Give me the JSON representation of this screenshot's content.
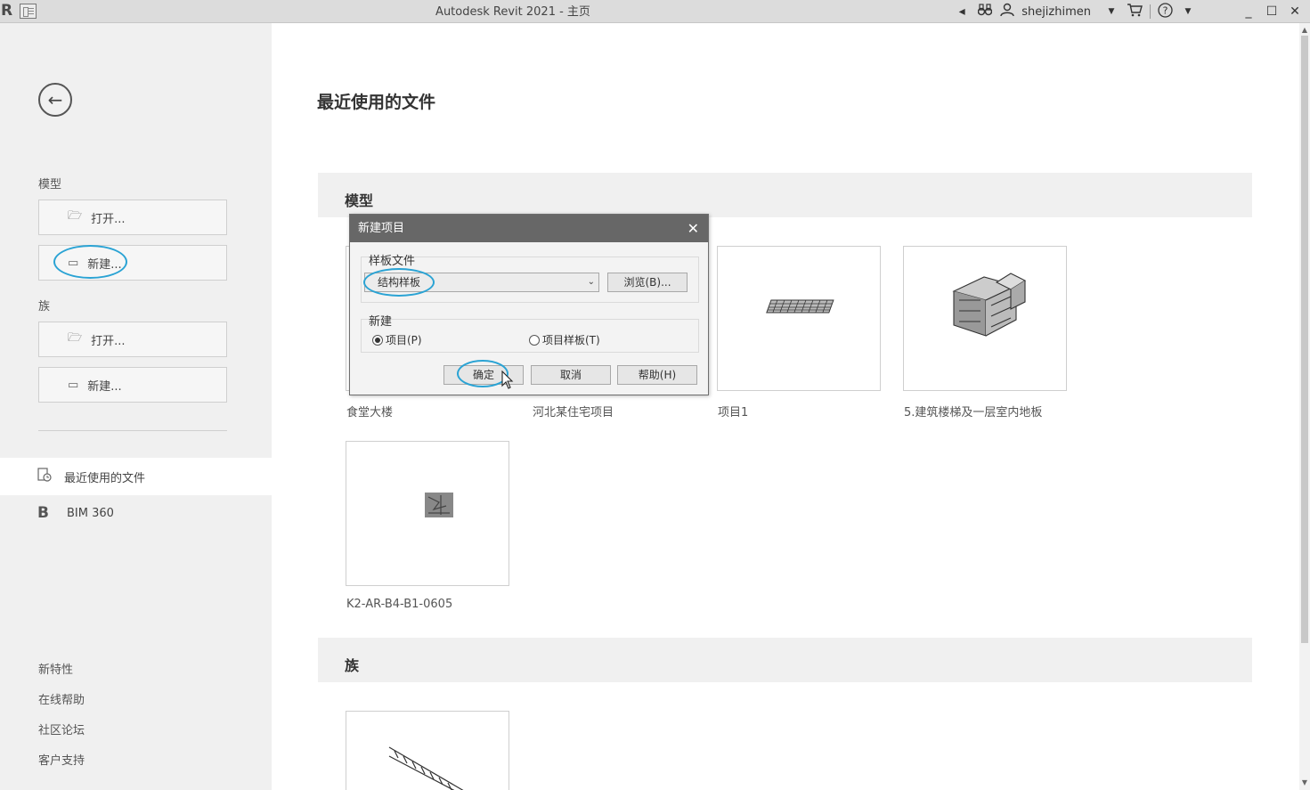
{
  "titlebar": {
    "app_logo": "R",
    "title": "Autodesk Revit 2021 - 主页",
    "username": "shejizhimen",
    "colors": {
      "bar": "#dcdcdc"
    }
  },
  "sidebar": {
    "model_heading": "模型",
    "model_open": "打开...",
    "model_new": "新建...",
    "family_heading": "族",
    "family_open": "打开...",
    "family_new": "新建...",
    "recent_files": "最近使用的文件",
    "bim360": "BIM 360",
    "bim360_icon_letter": "B",
    "links": [
      "新特性",
      "在线帮助",
      "社区论坛",
      "客户支持"
    ]
  },
  "main": {
    "title": "最近使用的文件",
    "models_section": "模型",
    "families_section": "族",
    "model_tiles": [
      {
        "label": "食堂大楼"
      },
      {
        "label": "河北某住宅项目"
      },
      {
        "label": "项目1"
      },
      {
        "label": "5.建筑楼梯及一层室内地板"
      },
      {
        "label": "K2-AR-B4-B1-0605"
      }
    ]
  },
  "dialog": {
    "title": "新建项目",
    "template_group": "样板文件",
    "template_selected": "结构样板",
    "browse_button": "浏览(B)...",
    "new_group": "新建",
    "radio_project": "项目(P)",
    "radio_template": "项目样板(T)",
    "radio_project_checked": true,
    "ok_button": "确定",
    "cancel_button": "取消",
    "help_button": "帮助(H)"
  },
  "icons": {
    "back": "arrow-left-icon",
    "folder": "folder-open-icon",
    "new": "new-file-icon",
    "recent": "recent-files-icon",
    "close": "close-icon"
  },
  "colors": {
    "highlight": "#2aa3d4",
    "dialog_title": "#676767",
    "sidebar": "#f0f0f0"
  }
}
